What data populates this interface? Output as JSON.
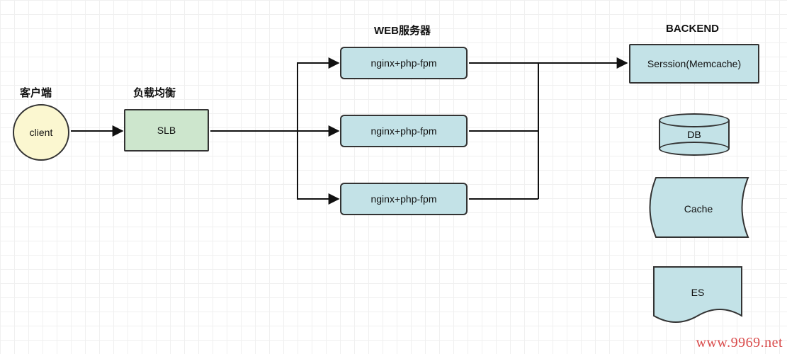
{
  "labels": {
    "client_header": "客户端",
    "lb_header": "负载均衡",
    "web_header": "WEB服务器",
    "backend_header": "BACKEND"
  },
  "nodes": {
    "client": "client",
    "slb": "SLB",
    "web1": "nginx+php-fpm",
    "web2": "nginx+php-fpm",
    "web3": "nginx+php-fpm",
    "session": "Serssion(Memcache)",
    "db": "DB",
    "cache": "Cache",
    "es": "ES"
  },
  "watermark": "www.9969.net",
  "colors": {
    "yellow": "#fbf7d0",
    "green": "#cde6cd",
    "blue": "#c3e2e7",
    "stroke": "#333333"
  }
}
